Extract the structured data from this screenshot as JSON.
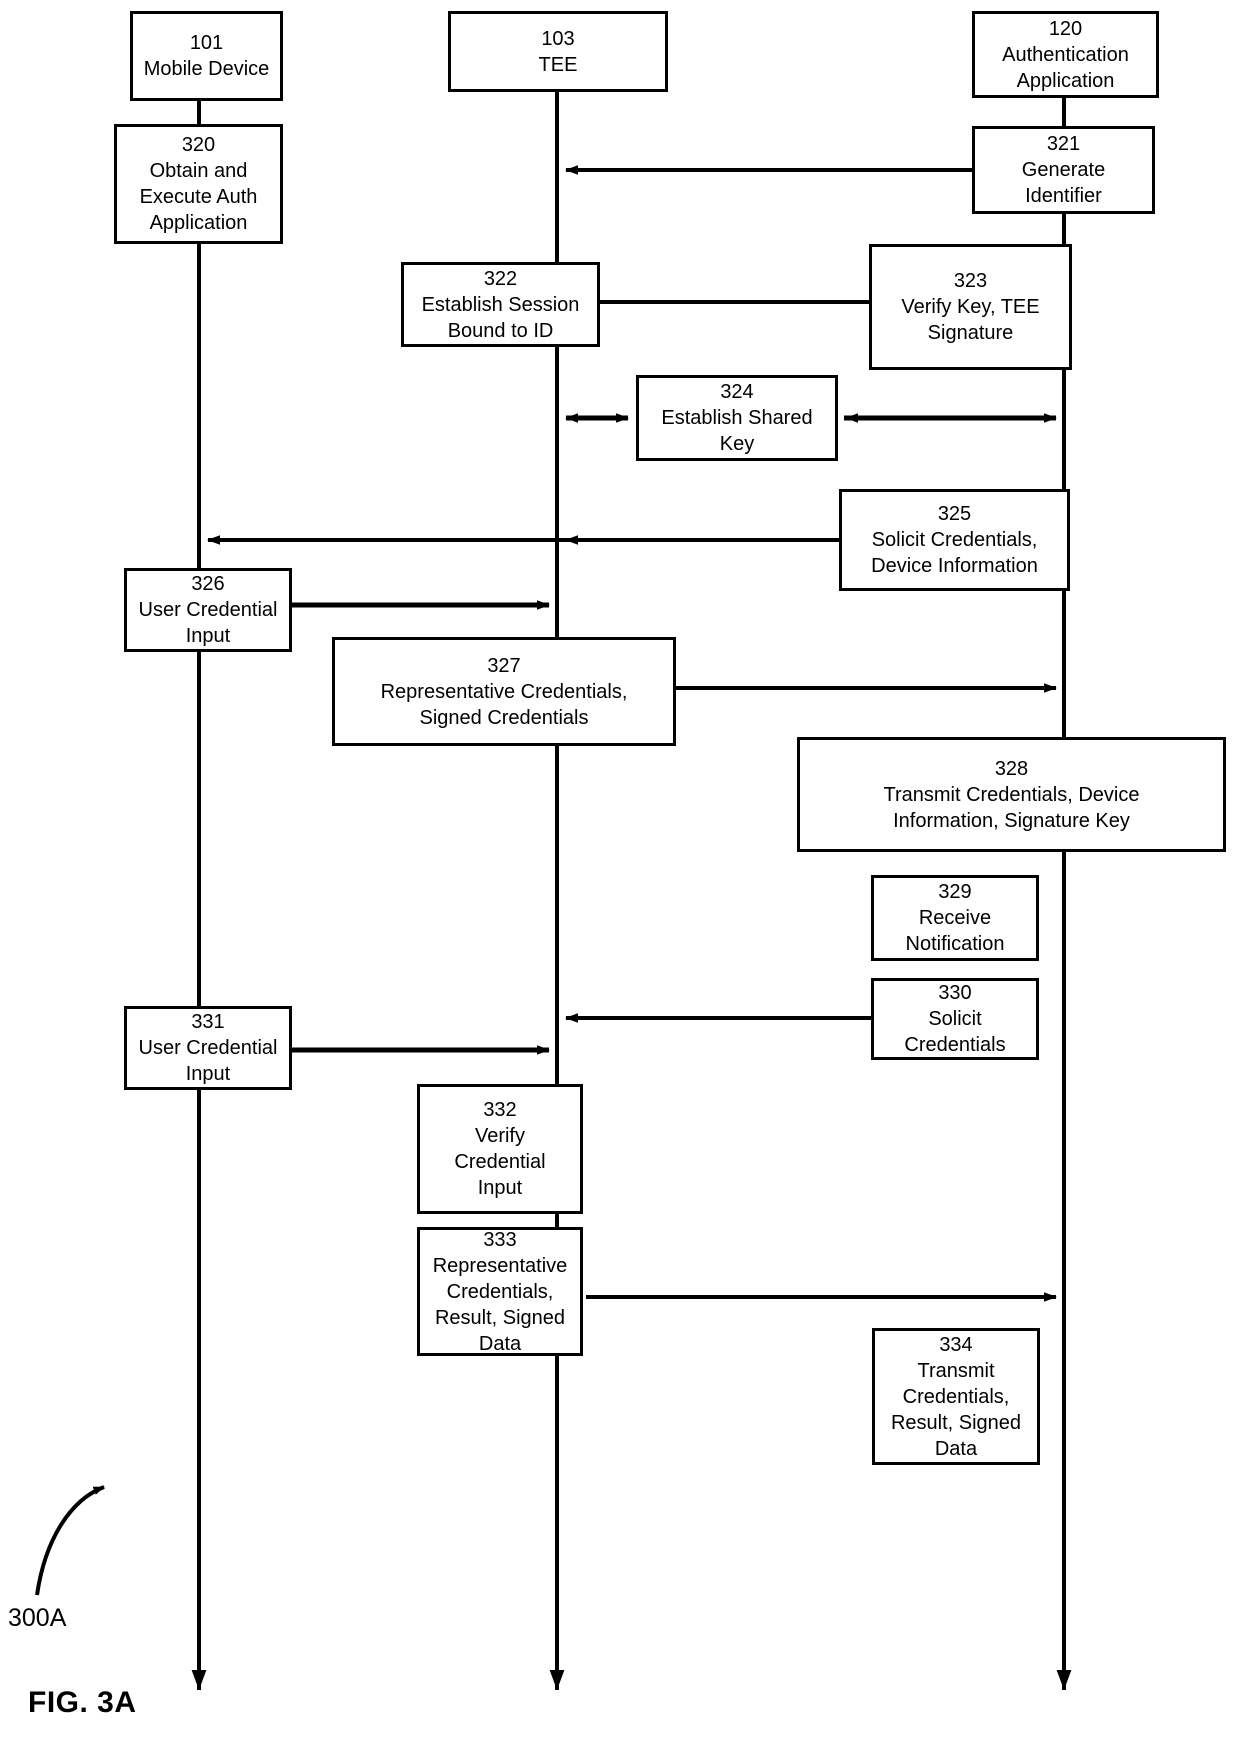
{
  "figure": {
    "caption": "FIG. 3A",
    "diagram_reference": "300A",
    "type": "patent-sequence-diagram",
    "background_color": "#ffffff",
    "line_color": "#000000"
  },
  "lanes": [
    {
      "id": "mobile-device",
      "ref": "101",
      "label": "Mobile Device"
    },
    {
      "id": "tee",
      "ref": "103",
      "label": "TEE"
    },
    {
      "id": "authentication-application",
      "ref": "120",
      "label": "Authentication\nApplication"
    }
  ],
  "steps": [
    {
      "id": "320",
      "ref": "320",
      "label": "Obtain and\nExecute Auth\nApplication",
      "lane": "mobile-device"
    },
    {
      "id": "321",
      "ref": "321",
      "label": "Generate\nIdentifier",
      "lane": "authentication-application"
    },
    {
      "id": "322",
      "ref": "322",
      "label": "Establish Session\nBound to ID",
      "lane": "tee"
    },
    {
      "id": "323",
      "ref": "323",
      "label": "Verify Key, TEE\nSignature",
      "lane": "authentication-application"
    },
    {
      "id": "324",
      "ref": "324",
      "label": "Establish Shared\nKey",
      "lane": "between-tee-and-auth"
    },
    {
      "id": "325",
      "ref": "325",
      "label": "Solicit Credentials,\nDevice Information",
      "lane": "authentication-application"
    },
    {
      "id": "326",
      "ref": "326",
      "label": "User Credential\nInput",
      "lane": "mobile-device"
    },
    {
      "id": "327",
      "ref": "327",
      "label": "Representative Credentials,\nSigned Credentials",
      "lane": "tee"
    },
    {
      "id": "328",
      "ref": "328",
      "label": "Transmit Credentials, Device\nInformation, Signature Key",
      "lane": "authentication-application"
    },
    {
      "id": "329",
      "ref": "329",
      "label": "Receive\nNotification",
      "lane": "authentication-application"
    },
    {
      "id": "330",
      "ref": "330",
      "label": "Solicit\nCredentials",
      "lane": "authentication-application"
    },
    {
      "id": "331",
      "ref": "331",
      "label": "User Credential\nInput",
      "lane": "mobile-device"
    },
    {
      "id": "332",
      "ref": "332",
      "label": "Verify\nCredential\nInput",
      "lane": "tee"
    },
    {
      "id": "333",
      "ref": "333",
      "label": "Representative\nCredentials,\nResult, Signed\nData",
      "lane": "tee"
    },
    {
      "id": "334",
      "ref": "334",
      "label": "Transmit\nCredentials,\nResult, Signed\nData",
      "lane": "authentication-application"
    }
  ],
  "messages": [
    {
      "from": "321",
      "to": "tee-lifeline",
      "direction": "left",
      "description": "Generate Identifier to TEE"
    },
    {
      "from": "322",
      "to": "323",
      "direction": "right",
      "description": "Establish Session Bound to ID to Verify Key, TEE Signature"
    },
    {
      "from": "tee-lifeline",
      "to": "324",
      "direction": "bidirectional",
      "description": "TEE to Establish Shared Key"
    },
    {
      "from": "324",
      "to": "auth-lifeline",
      "direction": "bidirectional",
      "description": "Establish Shared Key to Authentication Application"
    },
    {
      "from": "325",
      "to": "mobile-device-lifeline",
      "direction": "left",
      "description": "Solicit Credentials, Device Information to TEE and Mobile Device"
    },
    {
      "from": "326",
      "to": "tee-lifeline",
      "direction": "right",
      "description": "User Credential Input to TEE"
    },
    {
      "from": "327",
      "to": "auth-lifeline",
      "direction": "right",
      "description": "Representative Credentials, Signed Credentials to Authentication Application"
    },
    {
      "from": "330",
      "to": "tee-lifeline",
      "direction": "left",
      "description": "Solicit Credentials to TEE"
    },
    {
      "from": "331",
      "to": "tee-lifeline",
      "direction": "right",
      "description": "User Credential Input to TEE"
    },
    {
      "from": "333",
      "to": "auth-lifeline",
      "direction": "right",
      "description": "Representative Credentials, Result, Signed Data to Authentication Application"
    }
  ]
}
